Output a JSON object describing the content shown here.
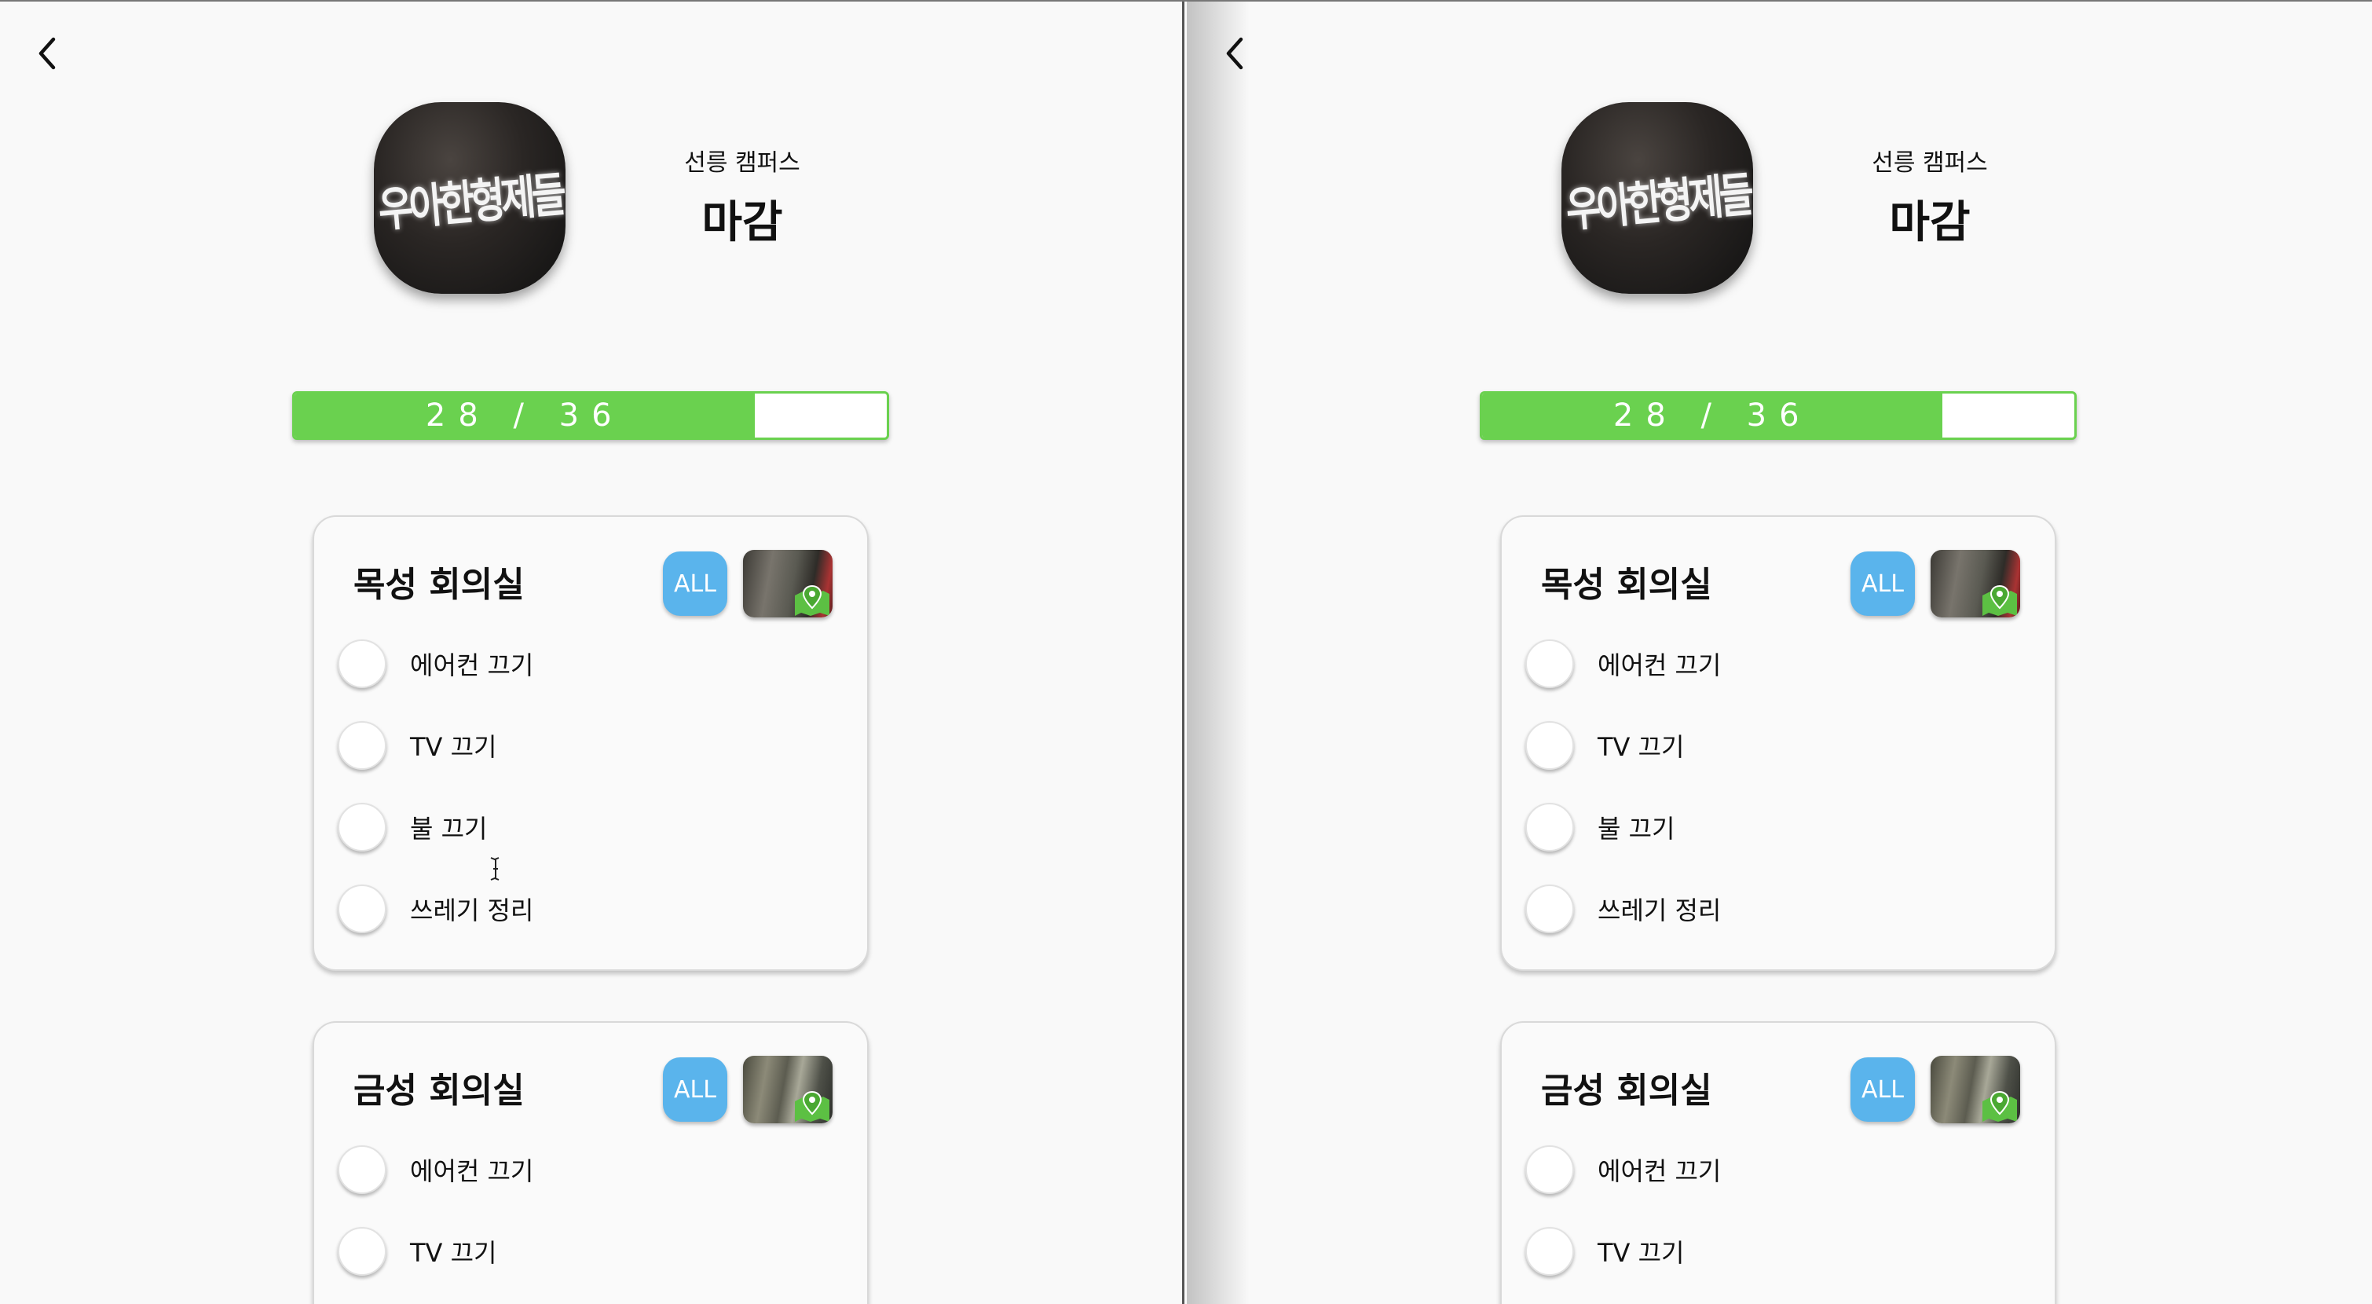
{
  "app": {
    "campus": "선릉 캠퍼스",
    "status": "마감",
    "logo_text": "우아한형제들"
  },
  "progress": {
    "label": "28 / 36",
    "completed": 28,
    "total": 36,
    "fraction": 0.7778
  },
  "rooms": [
    {
      "name": "목성 회의실",
      "all_label": "ALL",
      "tasks": [
        "에어컨 끄기",
        "TV 끄기",
        "불 끄기",
        "쓰레기 정리"
      ]
    },
    {
      "name": "금성 회의실",
      "all_label": "ALL",
      "tasks": [
        "에어컨 끄기",
        "TV 끄기"
      ]
    }
  ],
  "colors": {
    "progress_green": "#6ad14f",
    "all_button_blue": "#5ab4ec",
    "map_pin_green": "#5cc043"
  },
  "icons": {
    "back": "chevron-left-icon",
    "map": "map-pin-icon"
  }
}
